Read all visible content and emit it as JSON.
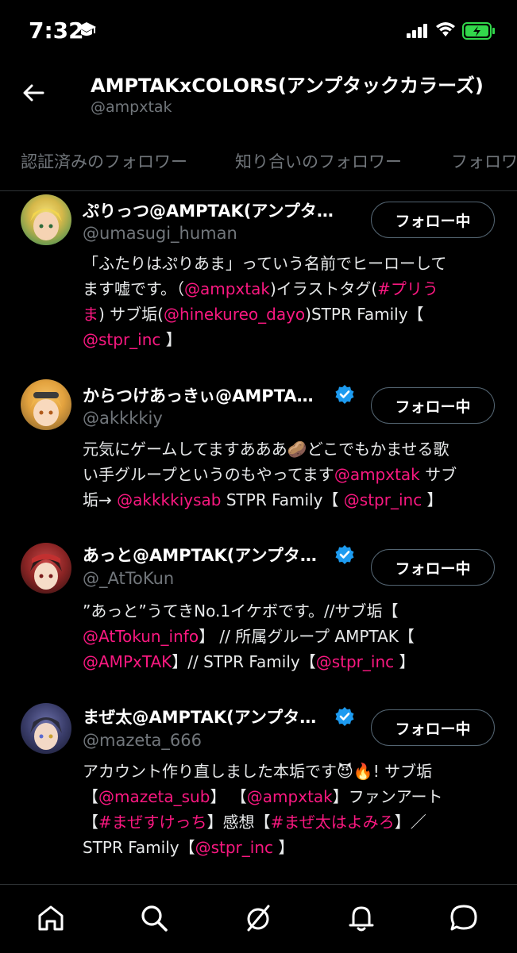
{
  "status_bar": {
    "time": "7:32"
  },
  "header": {
    "title": "AMPTAKxCOLORS(アンプタックカラーズ)",
    "handle": "@ampxtak"
  },
  "tabs": [
    "認証済みのフォロワー",
    "知り合いのフォロワー",
    "フォロワー"
  ],
  "follow_label": "フォロー中",
  "users": [
    {
      "name": "ぷりっつ@AMPTAK(アンプタ…",
      "handle": "@umasugi_human",
      "verified": false,
      "bio": [
        "「ふたりはぷりあま」っていう名前でヒーローして",
        "ます嘘です。（",
        "@ampxtak",
        ")イラストタグ(",
        "#プリう",
        "ま",
        ") サブ垢(",
        "@hinekureo_dayo",
        ")STPR Family【",
        "@stpr_inc",
        " 】"
      ]
    },
    {
      "name": "からつけあっきぃ@AMPTA…",
      "handle": "@akkkkiy",
      "verified": true,
      "bio": [
        "元気にゲームしてますあああ",
        "🥔",
        "どこでもかませる歌",
        "い手グループというのもやってます",
        "@ampxtak",
        " サブ",
        "垢→ ",
        "@akkkkiysab",
        " STPR Family【 ",
        "@stpr_inc",
        " 】"
      ]
    },
    {
      "name": "あっと@AMPTAK(アンプタ…",
      "handle": "@_AtToKun",
      "verified": true,
      "bio": [
        "”あっと”うてきNo.1イケボです。//サブ垢【",
        "@AtTokun_info",
        "】 // 所属グループ AMPTAK【",
        "@AMPxTAK",
        "】// STPR Family【",
        "@stpr_inc",
        " 】"
      ]
    },
    {
      "name": "まぜ太@AMPTAK(アンプタ…",
      "handle": "@mazeta_666",
      "verified": true,
      "bio": [
        "アカウント作り直しました本垢です",
        "😈🔥",
        "! サブ垢",
        "【",
        "@mazeta_sub",
        "】 【",
        "@ampxtak",
        "】ファンアート",
        "【",
        "#まぜすけっち",
        "】感想【",
        "#まぜ太はよみろ",
        "】／",
        "STPR Family【",
        "@stpr_inc",
        " 】"
      ]
    }
  ],
  "icons": [
    "graduation-cap-icon",
    "back-arrow-icon",
    "verified-badge-icon",
    "home-icon",
    "search-icon",
    "spaces-icon",
    "notifications-icon",
    "messages-icon"
  ],
  "colors": {
    "accent_pink": "#f91880",
    "verified_blue": "#1d9bf0",
    "muted": "#71767b",
    "battery_green": "#32d74b"
  }
}
